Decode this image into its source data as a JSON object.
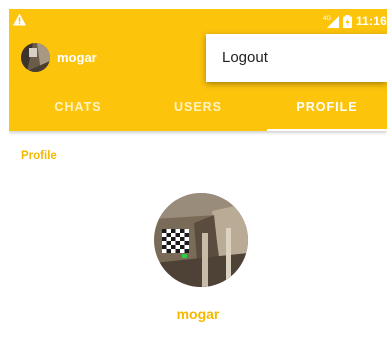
{
  "status_bar": {
    "time": "11:16",
    "network": "4G",
    "warning_icon": "warning-icon"
  },
  "toolbar": {
    "username": "mogar"
  },
  "menu": {
    "items": [
      {
        "label": "Logout"
      }
    ]
  },
  "tabs": [
    {
      "label": "CHATS",
      "active": false
    },
    {
      "label": "USERS",
      "active": false
    },
    {
      "label": "PROFILE",
      "active": true
    }
  ],
  "profile": {
    "section_title": "Profile",
    "name": "mogar"
  },
  "colors": {
    "primary": "#fdc40c",
    "accent_text": "#f5b800"
  }
}
